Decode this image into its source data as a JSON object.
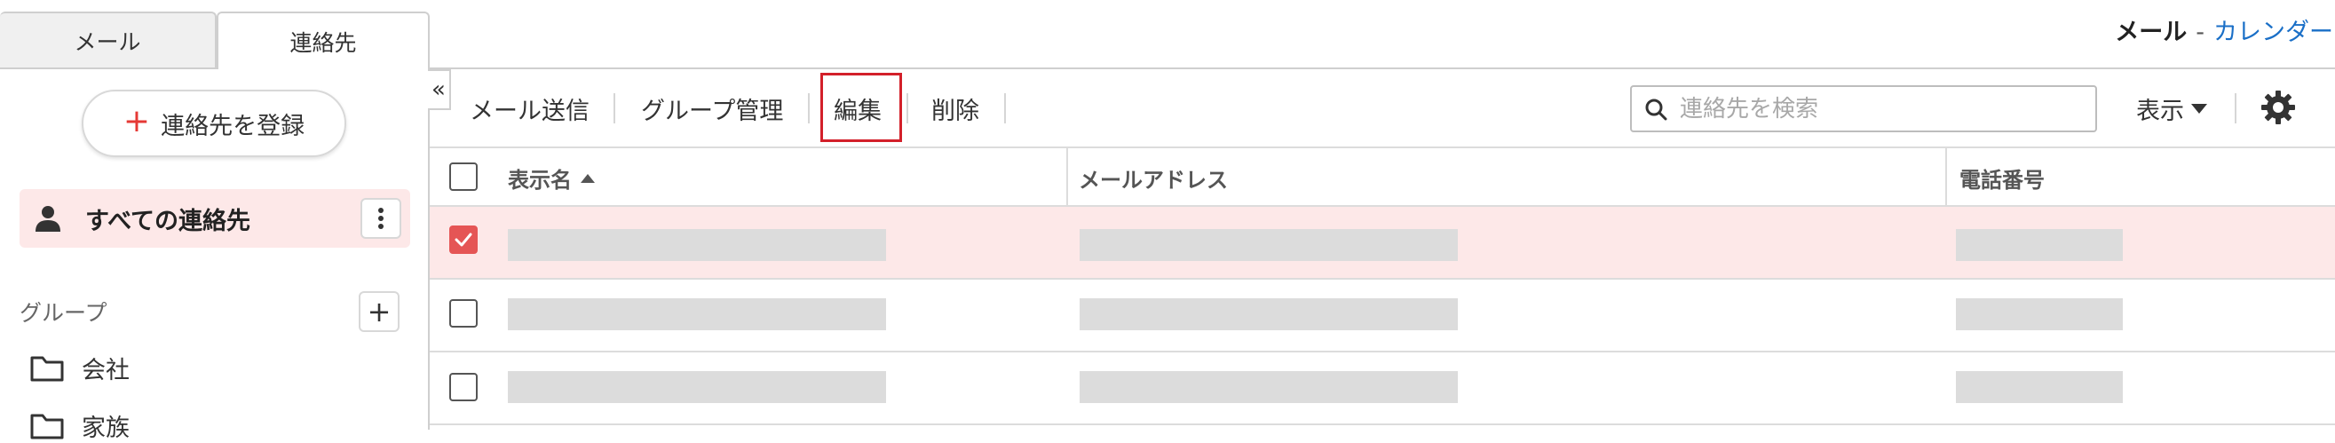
{
  "tabs": {
    "mail": "メール",
    "contacts": "連絡先"
  },
  "app_switch": {
    "current": "メール",
    "separator": "-",
    "other": "カレンダー"
  },
  "sidebar": {
    "register_button": "連絡先を登録",
    "all_contacts": "すべての連絡先",
    "groups_heading": "グループ",
    "groups": [
      {
        "label": "会社"
      },
      {
        "label": "家族"
      }
    ]
  },
  "toolbar": {
    "send_mail": "メール送信",
    "group_manage": "グループ管理",
    "edit": "編集",
    "delete": "削除",
    "view": "表示"
  },
  "search": {
    "placeholder": "連絡先を検索",
    "value": ""
  },
  "table": {
    "columns": {
      "name": "表示名",
      "email": "メールアドレス",
      "phone": "電話番号"
    },
    "rows": [
      {
        "selected": true
      },
      {
        "selected": false
      },
      {
        "selected": false
      }
    ]
  },
  "colors": {
    "accent_red": "#e53935",
    "selection_bg": "#fde8e8",
    "link_blue": "#1a6fc7",
    "highlight_border": "#d3202a"
  },
  "icons": {
    "collapse": "double-chevron-left-icon",
    "search": "search-icon",
    "settings": "gear-icon",
    "person": "person-icon",
    "more": "vertical-dots-icon",
    "folder": "folder-icon",
    "checkmark": "checkmark-icon"
  }
}
